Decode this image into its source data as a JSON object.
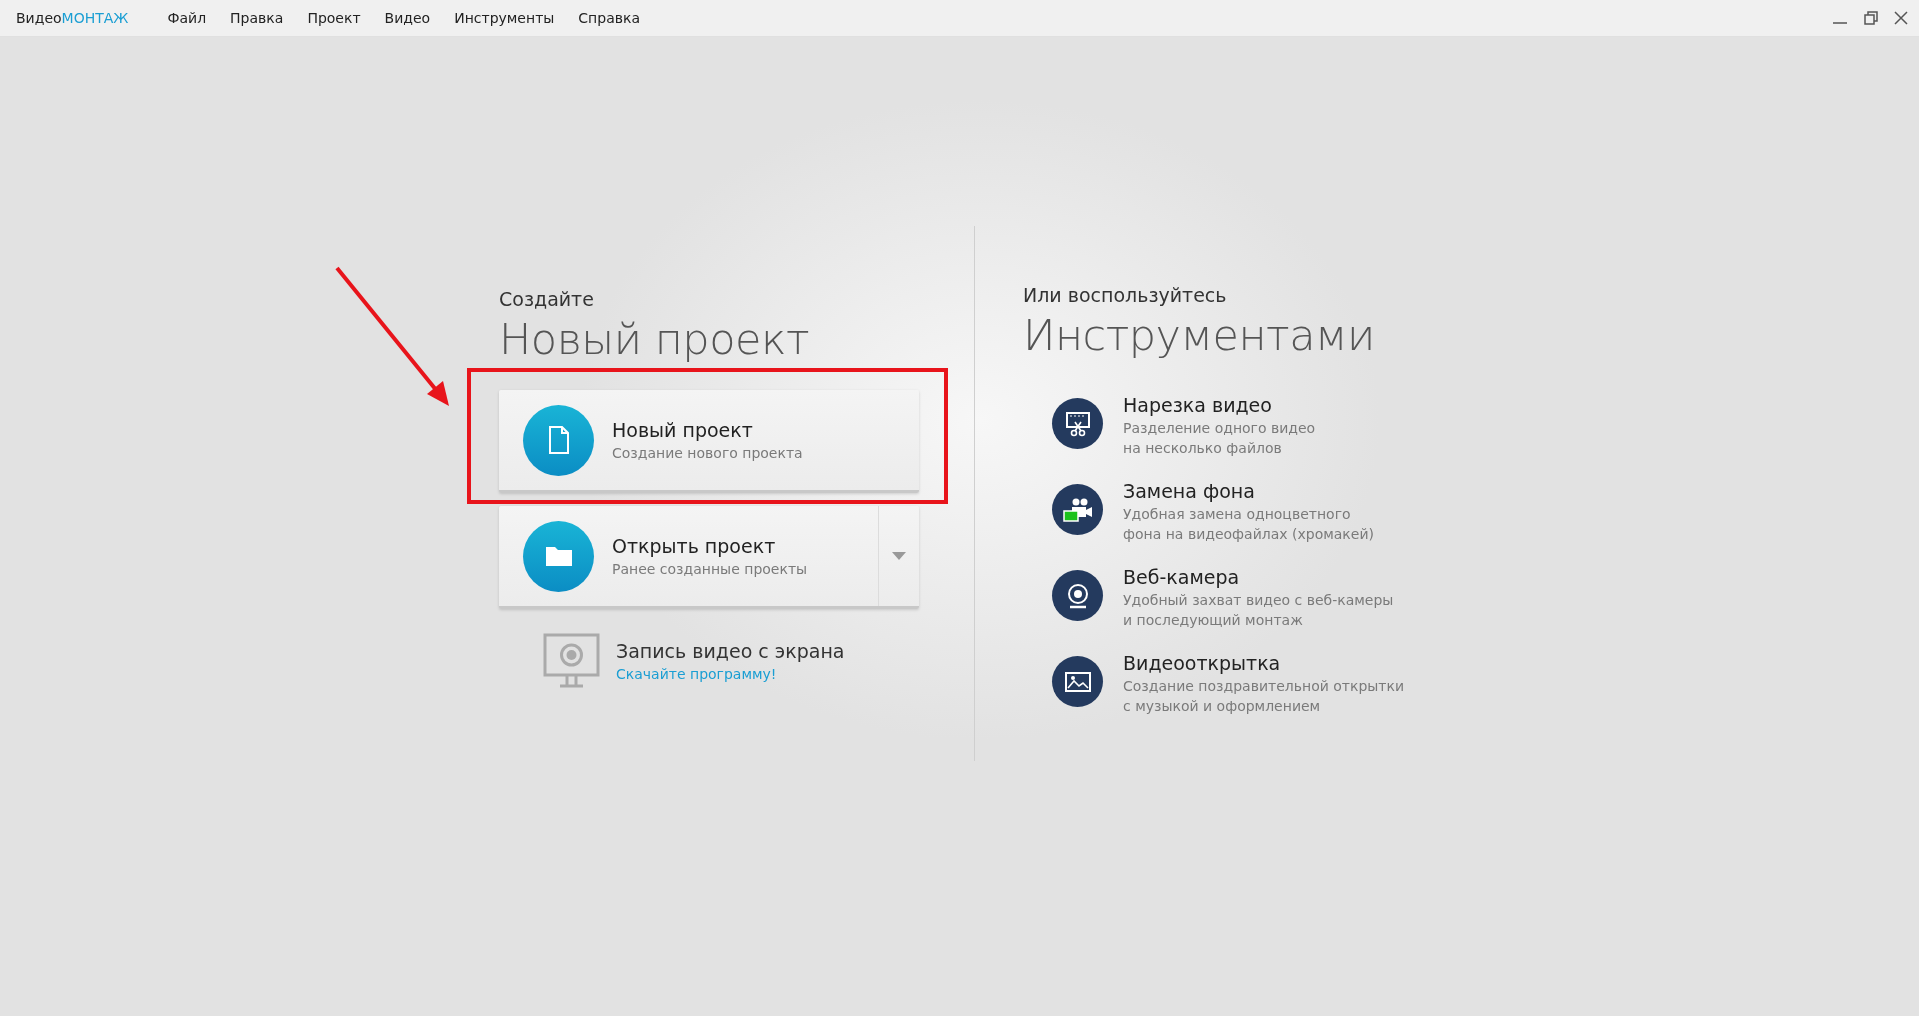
{
  "logo": {
    "text": "Видео",
    "accent": "МОНТАЖ"
  },
  "menu": [
    {
      "label": "Файл"
    },
    {
      "label": "Правка"
    },
    {
      "label": "Проект"
    },
    {
      "label": "Видео"
    },
    {
      "label": "Инструменты"
    },
    {
      "label": "Справка"
    }
  ],
  "create": {
    "eyebrow": "Создайте",
    "title": "Новый проект",
    "cards": [
      {
        "kind": "new",
        "title": "Новый проект",
        "subtitle": "Создание нового проекта",
        "annotated": true,
        "dropdown": false
      },
      {
        "kind": "open",
        "title": "Открыть проект",
        "subtitle": "Ранее созданные проекты",
        "annotated": false,
        "dropdown": true
      }
    ],
    "screen_record": {
      "title": "Запись видео с экрана",
      "link": "Скачайте программу!"
    }
  },
  "tools": {
    "eyebrow": "Или воспользуйтесь",
    "title": "Инструментами",
    "items": [
      {
        "kind": "cut",
        "title": "Нарезка видео",
        "description": [
          "Разделение одного видео",
          "на несколько файлов"
        ]
      },
      {
        "kind": "chroma",
        "title": "Замена фона",
        "description": [
          "Удобная замена одноцветного",
          "фона на видеофайлах (хромакей)"
        ]
      },
      {
        "kind": "webcam",
        "title": "Веб-камера",
        "description": [
          "Удобный захват видео с веб-камеры",
          "и последующий монтаж"
        ]
      },
      {
        "kind": "card",
        "title": "Видеооткрытка",
        "description": [
          "Создание поздравительной открытки",
          "с музыкой и оформлением"
        ]
      }
    ]
  }
}
